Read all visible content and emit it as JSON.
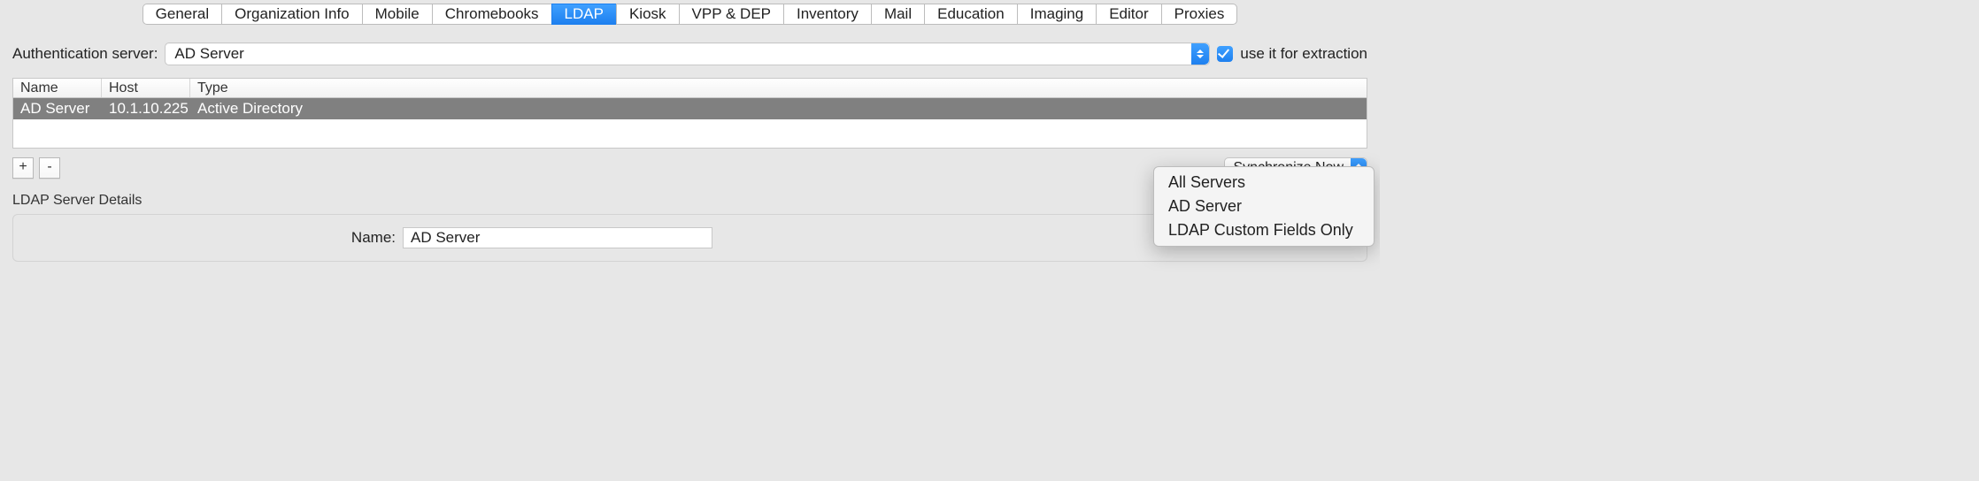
{
  "tabs": [
    {
      "label": "General"
    },
    {
      "label": "Organization Info"
    },
    {
      "label": "Mobile"
    },
    {
      "label": "Chromebooks"
    },
    {
      "label": "LDAP",
      "active": true
    },
    {
      "label": "Kiosk"
    },
    {
      "label": "VPP & DEP"
    },
    {
      "label": "Inventory"
    },
    {
      "label": "Mail"
    },
    {
      "label": "Education"
    },
    {
      "label": "Imaging"
    },
    {
      "label": "Editor"
    },
    {
      "label": "Proxies"
    }
  ],
  "auth": {
    "label": "Authentication server:",
    "selected": "AD Server",
    "checkbox_label": "use it for extraction",
    "checkbox_checked": true
  },
  "table": {
    "columns": {
      "name": "Name",
      "host": "Host",
      "type": "Type"
    },
    "rows": [
      {
        "name": "AD Server",
        "host": "10.1.10.225",
        "type": "Active Directory"
      }
    ]
  },
  "add_btn": "+",
  "remove_btn": "-",
  "sync": {
    "label": "Synchronize Now"
  },
  "section_label": "LDAP Server Details",
  "details": {
    "name_label": "Name:",
    "name_value": "AD Server"
  },
  "sync_menu": {
    "items": [
      {
        "label": "All Servers"
      },
      {
        "label": "AD Server"
      },
      {
        "label": "LDAP Custom Fields Only"
      }
    ]
  }
}
